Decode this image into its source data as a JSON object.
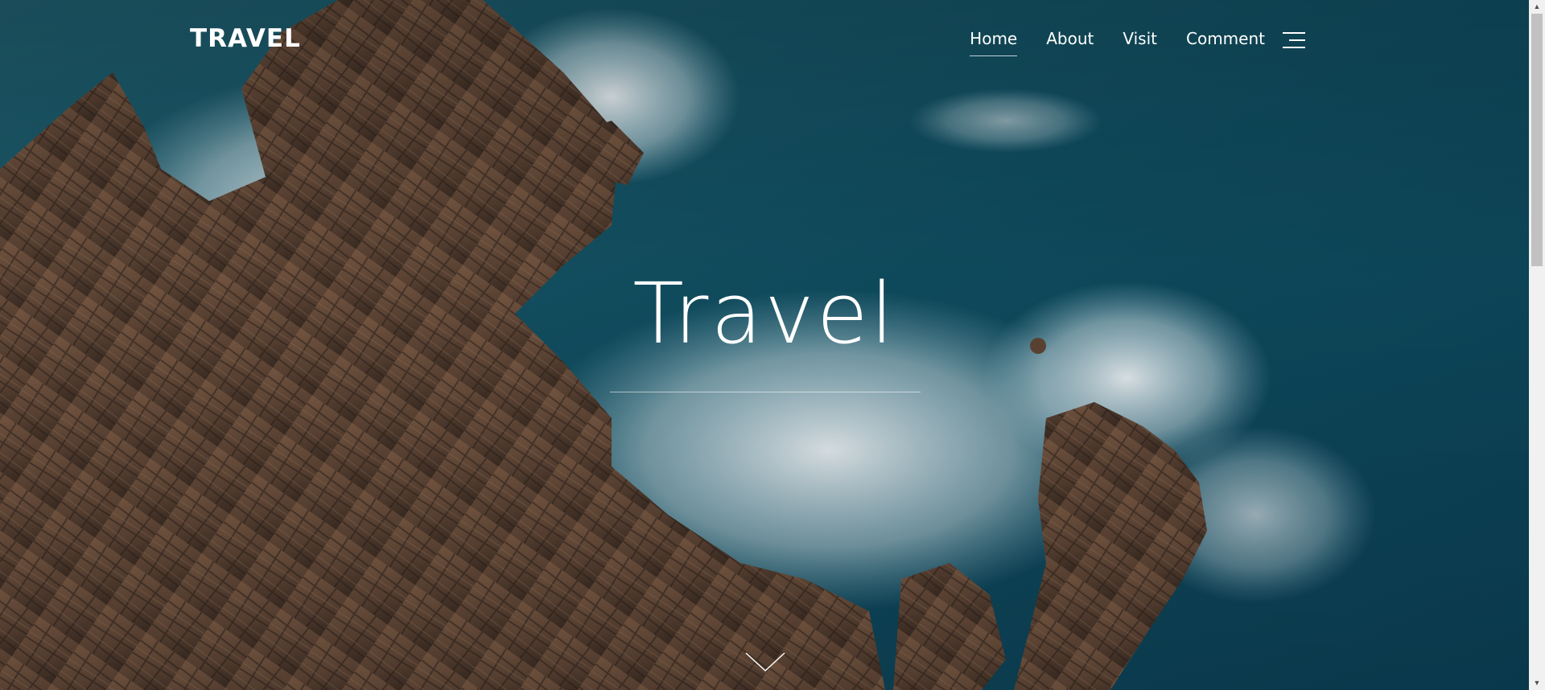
{
  "header": {
    "logo": "TRAVEL",
    "nav": [
      {
        "label": "Home",
        "active": true
      },
      {
        "label": "About",
        "active": false
      },
      {
        "label": "Visit",
        "active": false
      },
      {
        "label": "Comment",
        "active": false
      }
    ],
    "menu_icon": "hamburger-menu-icon"
  },
  "hero": {
    "title": "Travel",
    "scroll_icon": "chevron-down-icon",
    "background": "aerial-rocky-coastline-ocean"
  },
  "colors": {
    "text": "#ffffff",
    "ocean": "#0d4b5e",
    "rock": "#6e4f3a",
    "foam": "#e8f1f5"
  },
  "scrollbar": {
    "up_icon": "▲",
    "down_icon": "▼"
  }
}
